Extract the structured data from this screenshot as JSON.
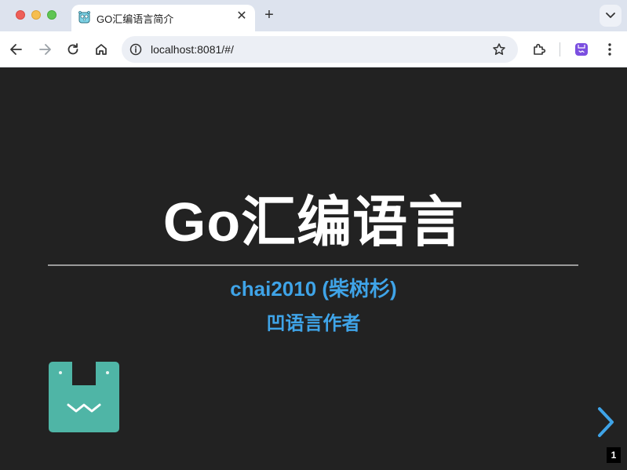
{
  "browser": {
    "tab": {
      "title": "GO汇编语言简介",
      "close_glyph": "✕",
      "favicon": "gopher-icon"
    },
    "new_tab_glyph": "+",
    "address_bar": {
      "url": "localhost:8081/#/"
    },
    "icons": [
      "back-icon",
      "forward-icon",
      "reload-icon",
      "home-icon",
      "site-info-icon",
      "bookmark-star-icon",
      "extensions-icon",
      "profile-icon",
      "menu-icon",
      "tab-search-icon"
    ]
  },
  "slide": {
    "title": "Go汇编语言",
    "author": "chai2010 (柴树杉)",
    "role": "凹语言作者",
    "page_number": "1",
    "logo": "wa-language-logo",
    "next_icon": "chevron-right-icon",
    "colors": {
      "background": "#222222",
      "title": "#ffffff",
      "accent": "#3fa4e8",
      "logo": "#4fb5a6"
    }
  }
}
